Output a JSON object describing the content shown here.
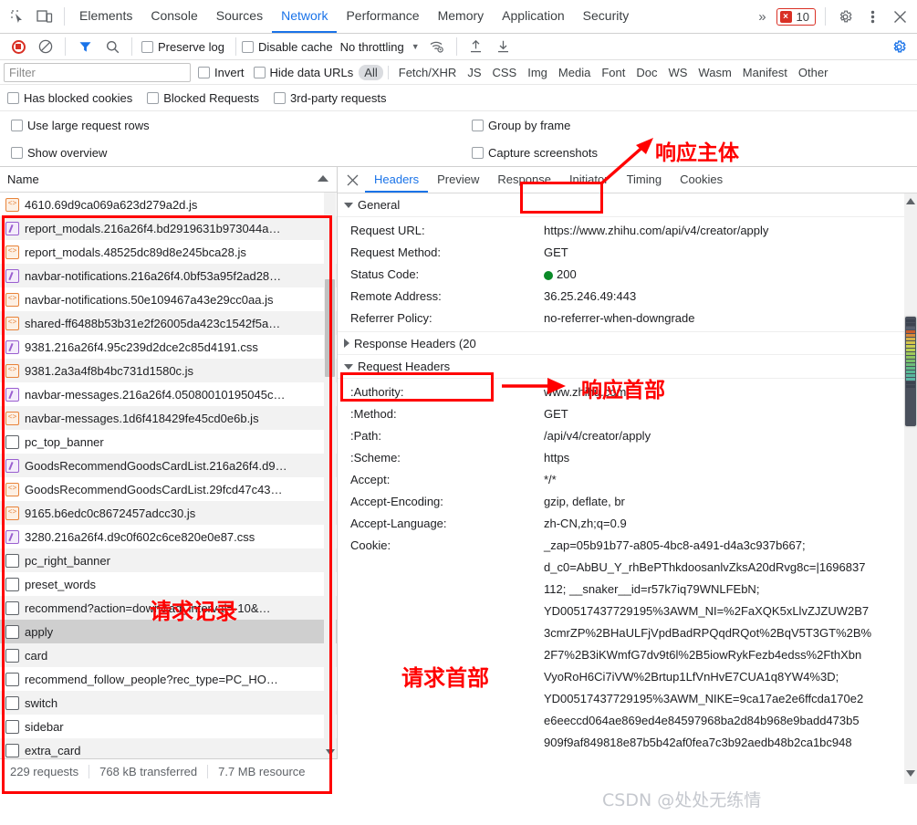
{
  "topbar": {
    "icons": [
      "inspect-element-icon",
      "device-toolbar-icon"
    ],
    "tabs": [
      {
        "label": "Elements",
        "active": false
      },
      {
        "label": "Console",
        "active": false
      },
      {
        "label": "Sources",
        "active": false
      },
      {
        "label": "Network",
        "active": true
      },
      {
        "label": "Performance",
        "active": false
      },
      {
        "label": "Memory",
        "active": false
      },
      {
        "label": "Application",
        "active": false
      },
      {
        "label": "Security",
        "active": false
      }
    ],
    "more_tabs": "»",
    "error_count": "10",
    "error_glyph": "×",
    "settings_icon": "gear-icon",
    "menu_icon": "kebab-menu-icon",
    "close_icon": "close-icon"
  },
  "nettoolbar": {
    "record_icon": "record-stop-icon",
    "clear_icon": "clear-icon",
    "filter_icon": "filter-funnel-icon",
    "search_icon": "search-icon",
    "preserve_log": "Preserve log",
    "disable_cache": "Disable cache",
    "throttling": "No throttling",
    "wifi_icon": "network-conditions-icon",
    "import_icon": "import-har-icon",
    "export_icon": "export-har-icon",
    "settings_icon": "network-settings-gear-icon"
  },
  "filterrow": {
    "placeholder": "Filter",
    "value": "",
    "invert": "Invert",
    "hide_data_urls": "Hide data URLs",
    "types": [
      "All",
      "Fetch/XHR",
      "JS",
      "CSS",
      "Img",
      "Media",
      "Font",
      "Doc",
      "WS",
      "Wasm",
      "Manifest",
      "Other"
    ],
    "selected_type": "All"
  },
  "options": {
    "has_blocked_cookies": "Has blocked cookies",
    "blocked_requests": "Blocked Requests",
    "third_party_requests": "3rd-party requests",
    "use_large_request_rows": "Use large request rows",
    "show_overview": "Show overview",
    "group_by_frame": "Group by frame",
    "capture_screenshots": "Capture screenshots"
  },
  "requestlist": {
    "column_header": "Name",
    "rows": [
      {
        "name": "4610.69d9ca069a623d279a2d.js",
        "type": "js",
        "selected": false
      },
      {
        "name": "report_modals.216a26f4.bd2919631b973044a…",
        "type": "css",
        "selected": false
      },
      {
        "name": "report_modals.48525dc89d8e245bca28.js",
        "type": "js",
        "selected": false
      },
      {
        "name": "navbar-notifications.216a26f4.0bf53a95f2ad28…",
        "type": "css",
        "selected": false
      },
      {
        "name": "navbar-notifications.50e109467a43e29cc0aa.js",
        "type": "js",
        "selected": false
      },
      {
        "name": "shared-ff6488b53b31e2f26005da423c1542f5a…",
        "type": "js",
        "selected": false
      },
      {
        "name": "9381.216a26f4.95c239d2dce2c85d4191.css",
        "type": "css",
        "selected": false
      },
      {
        "name": "9381.2a3a4f8b4bc731d1580c.js",
        "type": "js",
        "selected": false
      },
      {
        "name": "navbar-messages.216a26f4.05080010195045c…",
        "type": "css",
        "selected": false
      },
      {
        "name": "navbar-messages.1d6f418429fe45cd0e6b.js",
        "type": "js",
        "selected": false
      },
      {
        "name": "pc_top_banner",
        "type": "doc",
        "selected": false
      },
      {
        "name": "GoodsRecommendGoodsCardList.216a26f4.d9…",
        "type": "css",
        "selected": false
      },
      {
        "name": "GoodsRecommendGoodsCardList.29fcd47c43…",
        "type": "js",
        "selected": false
      },
      {
        "name": "9165.b6edc0c8672457adcc30.js",
        "type": "js",
        "selected": false
      },
      {
        "name": "3280.216a26f4.d9c0f602c6ce820e0e87.css",
        "type": "css",
        "selected": false
      },
      {
        "name": "pc_right_banner",
        "type": "doc",
        "selected": false
      },
      {
        "name": "preset_words",
        "type": "doc",
        "selected": false
      },
      {
        "name": "recommend?action=down&ad_interval=-10&…",
        "type": "doc",
        "selected": false
      },
      {
        "name": "apply",
        "type": "doc",
        "selected": true
      },
      {
        "name": "card",
        "type": "doc",
        "selected": false
      },
      {
        "name": "recommend_follow_people?rec_type=PC_HO…",
        "type": "doc",
        "selected": false
      },
      {
        "name": "switch",
        "type": "doc",
        "selected": false
      },
      {
        "name": "sidebar",
        "type": "doc",
        "selected": false
      },
      {
        "name": "extra_card",
        "type": "doc",
        "selected": false
      }
    ]
  },
  "statusbar": {
    "requests": "229 requests",
    "transferred": "768 kB transferred",
    "resources": "7.7 MB resource"
  },
  "details": {
    "close_icon": "close-panel-icon",
    "tabs": [
      {
        "label": "Headers",
        "active": true
      },
      {
        "label": "Preview",
        "active": false
      },
      {
        "label": "Response",
        "active": false
      },
      {
        "label": "Initiator",
        "active": false
      },
      {
        "label": "Timing",
        "active": false
      },
      {
        "label": "Cookies",
        "active": false
      }
    ],
    "general_section": "General",
    "general": [
      {
        "key": "Request URL:",
        "value": "https://www.zhihu.com/api/v4/creator/apply"
      },
      {
        "key": "Request Method:",
        "value": "GET"
      },
      {
        "key": "Status Code:",
        "value": "200",
        "dot": true
      },
      {
        "key": "Remote Address:",
        "value": "36.25.246.49:443"
      },
      {
        "key": "Referrer Policy:",
        "value": "no-referrer-when-downgrade"
      }
    ],
    "response_headers_section": "Response Headers (20",
    "request_headers_section": "Request Headers",
    "request_headers": [
      {
        "key": ":Authority:",
        "value": "www.zhihu.com"
      },
      {
        "key": ":Method:",
        "value": "GET"
      },
      {
        "key": ":Path:",
        "value": "/api/v4/creator/apply"
      },
      {
        "key": ":Scheme:",
        "value": "https"
      },
      {
        "key": "Accept:",
        "value": "*/*"
      },
      {
        "key": "Accept-Encoding:",
        "value": "gzip, deflate, br"
      },
      {
        "key": "Accept-Language:",
        "value": "zh-CN,zh;q=0.9"
      }
    ],
    "cookie_key": "Cookie:",
    "cookie_lines": [
      "_zap=05b91b77-a805-4bc8-a491-d4a3c937b667;",
      "d_c0=AbBU_Y_rhBePThkdoosanlvZksA20dRvg8c=|1696837",
      "112; __snaker__id=r57k7iq79WNLFEbN;",
      "YD00517437729195%3AWM_NI=%2FaXQK5xLlvZJZUW2B7",
      "3cmrZP%2BHaULFjVpdBadRPQqdRQot%2BqV5T3GT%2B%",
      "2F7%2B3iKWmfG7dv9t6l%2B5iowRykFezb4edss%2FthXbn",
      "VyoRoH6Ci7iVW%2Brtup1LfVnHvE7CUA1q8YW4%3D;",
      "YD00517437729195%3AWM_NIKE=9ca17ae2e6ffcda170e2",
      "e6eeccd064ae869ed4e84597968ba2d84b968e9badd473b5",
      "909f9af849818e87b5b42af0fea7c3b92aedb48b2ca1bc948"
    ]
  },
  "annotations": {
    "response_body": "响应主体",
    "response_headers": "响应首部",
    "request_records": "请求记录",
    "request_headers": "请求首部",
    "box_color": "#ff0000"
  },
  "watermark": {
    "text": "CSDN @处处无练情"
  }
}
